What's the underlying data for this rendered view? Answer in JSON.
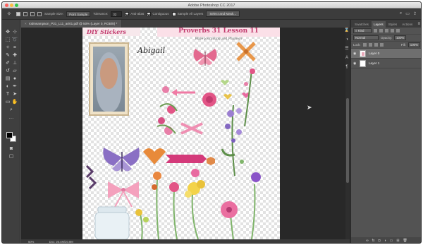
{
  "window": {
    "title": "Adobe Photoshop CC 2017"
  },
  "options_bar": {
    "sample_size_label": "Sample Size:",
    "sample_size_value": "Point Sample",
    "tolerance_label": "Tolerance:",
    "tolerance_value": "32",
    "anti_alias_label": "Anti-alias",
    "contiguous_label": "Contiguous",
    "sample_all_layers_label": "Sample All Layers",
    "select_mask_label": "Select and Mask..."
  },
  "document": {
    "tab_label": "robinsampson_P31_L11_art01.pdf @ 50% (Layer 0, RGB/8) *",
    "close_glyph": "×"
  },
  "artwork": {
    "header_left": "DIY Stickers",
    "header_title": "Proverbs 31 Lesson 11",
    "header_subtitle": "Bible Journaling and Planners",
    "name_text": "Abigail"
  },
  "status_bar": {
    "zoom": "50%",
    "doc_info": "Doc: 26.4M/20.8M"
  },
  "layers_panel": {
    "tabs": [
      "Swatches",
      "Layers",
      "Styles",
      "Actions"
    ],
    "kind_filter": "Kind",
    "blend_mode": "Normal",
    "opacity_label": "Opacity:",
    "opacity_value": "100%",
    "lock_label": "Lock:",
    "fill_label": "Fill:",
    "fill_value": "100%",
    "layers": [
      {
        "name": "Layer 0",
        "selected": true
      },
      {
        "name": "Layer 1",
        "selected": false
      }
    ]
  },
  "colors": {
    "foreground": "#000000",
    "background": "#ffffff",
    "accent": "#c23b6e"
  }
}
